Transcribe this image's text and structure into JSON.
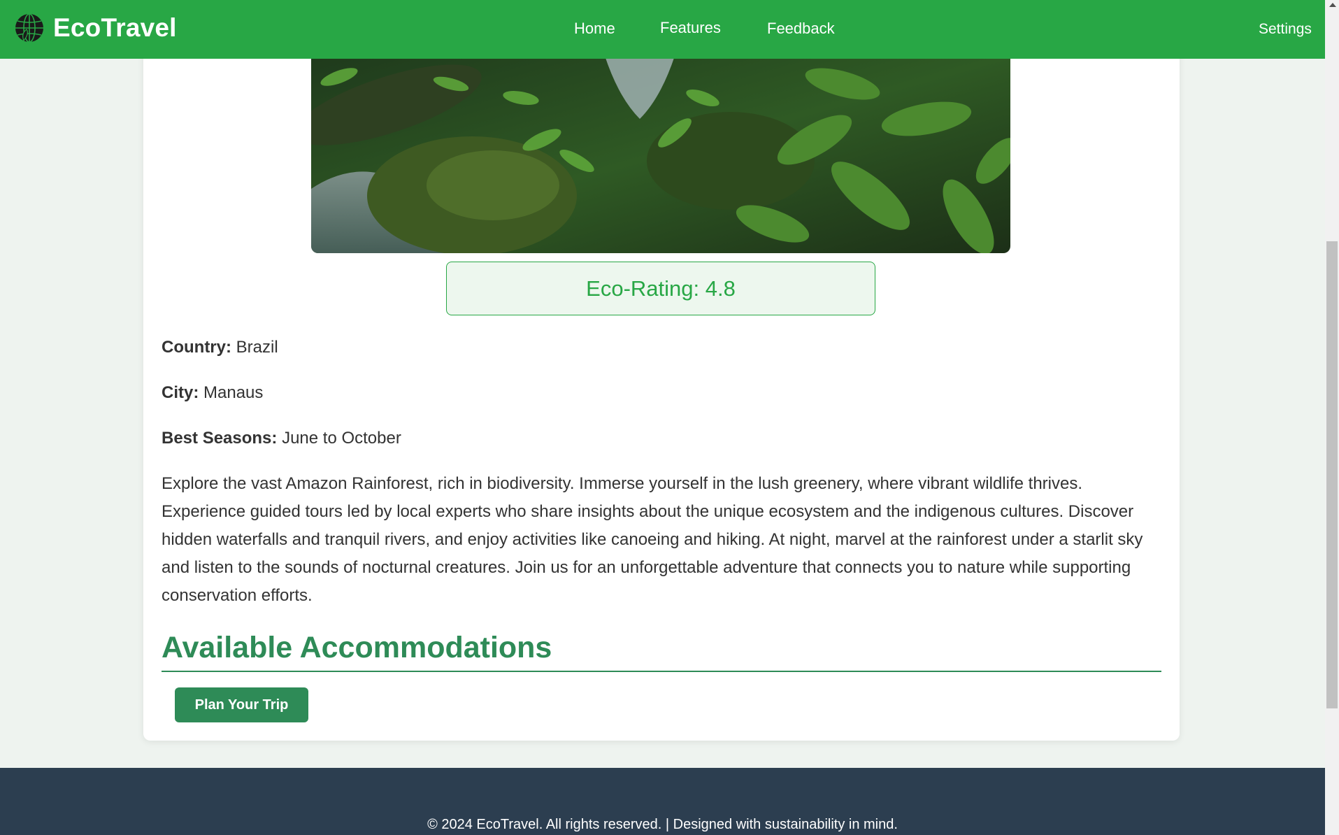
{
  "header": {
    "brand": "EcoTravel",
    "logo_icon": "globe-icon",
    "nav": {
      "home": "Home",
      "features": "Features",
      "feedback": "Feedback",
      "settings": "Settings"
    }
  },
  "destination": {
    "image_alt": "Rainforest stream with lush green plants",
    "eco_rating": "Eco-Rating: 4.8",
    "country_label": "Country:",
    "country": "Brazil",
    "city_label": "City:",
    "city": "Manaus",
    "season_label": "Best Seasons:",
    "season": "June to October",
    "description": "Explore the vast Amazon Rainforest, rich in biodiversity. Immerse yourself in the lush greenery, where vibrant wildlife thrives. Experience guided tours led by local experts who share insights about the unique ecosystem and the indigenous cultures. Discover hidden waterfalls and tranquil rivers, and enjoy activities like canoeing and hiking. At night, marvel at the rainforest under a starlit sky and listen to the sounds of nocturnal creatures. Join us for an unforgettable adventure that connects you to nature while supporting conservation efforts."
  },
  "accommodations": {
    "title": "Available Accommodations",
    "plan_button": "Plan Your Trip"
  },
  "footer": {
    "text": "© 2024 EcoTravel. All rights reserved. | Designed with sustainability in mind."
  },
  "colors": {
    "nav_bg": "#28a745",
    "accent": "#2e8b57",
    "footer_bg": "#2c3e50",
    "page_bg": "#eef3ef"
  }
}
